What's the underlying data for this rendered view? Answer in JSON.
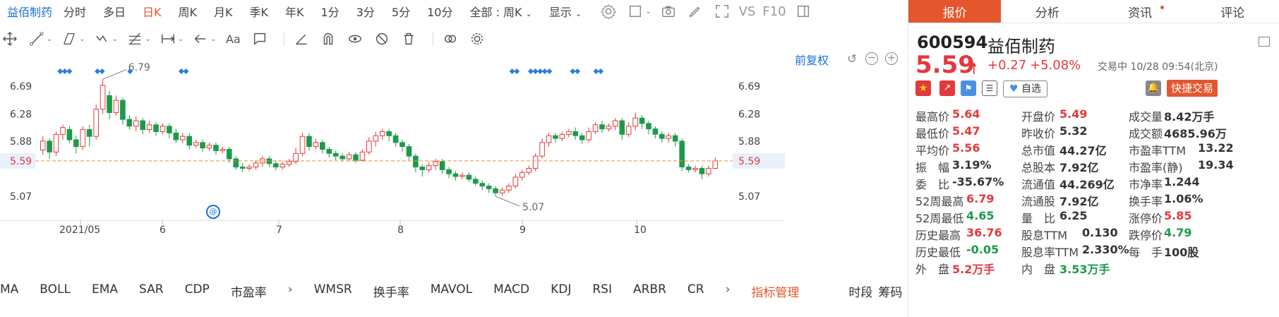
{
  "period_bar": {
    "stock_name": "益佰制药",
    "periods": [
      "分时",
      "多日",
      "日K",
      "周K",
      "月K",
      "季K",
      "年K",
      "1分",
      "3分",
      "5分",
      "10分"
    ],
    "active_index": 2,
    "range_select": "全部 : 周K",
    "display_label": "显示",
    "vs_label": "VS",
    "f10_label": "F10"
  },
  "chart_header": {
    "adjust_label": "前复权"
  },
  "chart_data": {
    "type": "candlestick",
    "price_ticks": [
      "6.69",
      "6.28",
      "5.88",
      "5.59",
      "5.07"
    ],
    "price_tick_values": [
      6.69,
      6.28,
      5.88,
      5.59,
      5.07
    ],
    "current_price_label": "5.59",
    "high_annotation": "6.79",
    "low_annotation": "5.07",
    "x_labels": [
      "2021/05",
      "6",
      "7",
      "8",
      "9",
      "10"
    ],
    "ylim": [
      4.8,
      7.0
    ],
    "up_color": "#e4393c",
    "down_color": "#1c9a4a",
    "candles": [
      [
        5.75,
        5.88,
        5.68,
        5.95
      ],
      [
        5.88,
        5.72,
        5.62,
        5.92
      ],
      [
        5.72,
        5.98,
        5.66,
        6.02
      ],
      [
        5.98,
        6.08,
        5.9,
        6.12
      ],
      [
        6.05,
        5.9,
        5.85,
        6.1
      ],
      [
        5.9,
        5.8,
        5.7,
        5.96
      ],
      [
        5.8,
        6.05,
        5.75,
        6.1
      ],
      [
        6.05,
        5.95,
        5.8,
        6.12
      ],
      [
        5.95,
        6.35,
        5.9,
        6.42
      ],
      [
        6.35,
        6.7,
        6.28,
        6.79
      ],
      [
        6.55,
        6.3,
        6.2,
        6.62
      ],
      [
        6.3,
        6.48,
        6.25,
        6.55
      ],
      [
        6.48,
        6.2,
        6.12,
        6.52
      ],
      [
        6.2,
        6.1,
        6.05,
        6.26
      ],
      [
        6.1,
        6.18,
        6.02,
        6.24
      ],
      [
        6.18,
        6.05,
        5.98,
        6.22
      ],
      [
        6.05,
        6.12,
        6.0,
        6.18
      ],
      [
        6.12,
        6.02,
        5.96,
        6.16
      ],
      [
        6.02,
        6.1,
        5.98,
        6.14
      ],
      [
        6.1,
        6.0,
        5.92,
        6.14
      ],
      [
        6.0,
        5.9,
        5.85,
        6.06
      ],
      [
        5.9,
        5.95,
        5.85,
        6.0
      ],
      [
        5.95,
        5.82,
        5.76,
        6.0
      ],
      [
        5.82,
        5.86,
        5.78,
        5.9
      ],
      [
        5.86,
        5.78,
        5.72,
        5.9
      ],
      [
        5.78,
        5.82,
        5.74,
        5.86
      ],
      [
        5.82,
        5.74,
        5.68,
        5.86
      ],
      [
        5.74,
        5.76,
        5.7,
        5.8
      ],
      [
        5.76,
        5.62,
        5.56,
        5.8
      ],
      [
        5.62,
        5.5,
        5.46,
        5.66
      ],
      [
        5.5,
        5.48,
        5.42,
        5.56
      ],
      [
        5.48,
        5.5,
        5.44,
        5.54
      ],
      [
        5.5,
        5.56,
        5.46,
        5.6
      ],
      [
        5.56,
        5.62,
        5.5,
        5.66
      ],
      [
        5.62,
        5.55,
        5.5,
        5.66
      ],
      [
        5.55,
        5.5,
        5.45,
        5.6
      ],
      [
        5.5,
        5.54,
        5.46,
        5.58
      ],
      [
        5.54,
        5.58,
        5.5,
        5.62
      ],
      [
        5.58,
        5.7,
        5.54,
        5.78
      ],
      [
        5.7,
        5.95,
        5.66,
        6.0
      ],
      [
        5.95,
        5.8,
        5.74,
        6.0
      ],
      [
        5.8,
        5.86,
        5.76,
        5.92
      ],
      [
        5.86,
        5.76,
        5.7,
        5.9
      ],
      [
        5.76,
        5.7,
        5.64,
        5.8
      ],
      [
        5.7,
        5.66,
        5.6,
        5.74
      ],
      [
        5.66,
        5.62,
        5.58,
        5.7
      ],
      [
        5.62,
        5.68,
        5.58,
        5.72
      ],
      [
        5.68,
        5.6,
        5.56,
        5.72
      ],
      [
        5.6,
        5.72,
        5.58,
        5.76
      ],
      [
        5.72,
        5.88,
        5.68,
        5.94
      ],
      [
        5.88,
        5.96,
        5.8,
        6.02
      ],
      [
        5.96,
        6.02,
        5.9,
        6.06
      ],
      [
        6.02,
        5.96,
        5.88,
        6.06
      ],
      [
        5.96,
        5.86,
        5.8,
        6.0
      ],
      [
        5.86,
        5.8,
        5.72,
        5.9
      ],
      [
        5.8,
        5.66,
        5.6,
        5.84
      ],
      [
        5.66,
        5.5,
        5.42,
        5.7
      ],
      [
        5.5,
        5.46,
        5.36,
        5.54
      ],
      [
        5.46,
        5.52,
        5.42,
        5.58
      ],
      [
        5.52,
        5.58,
        5.46,
        5.62
      ],
      [
        5.58,
        5.46,
        5.4,
        5.62
      ],
      [
        5.46,
        5.4,
        5.34,
        5.5
      ],
      [
        5.4,
        5.36,
        5.3,
        5.44
      ],
      [
        5.36,
        5.38,
        5.32,
        5.42
      ],
      [
        5.38,
        5.32,
        5.28,
        5.42
      ],
      [
        5.32,
        5.26,
        5.22,
        5.36
      ],
      [
        5.26,
        5.22,
        5.16,
        5.3
      ],
      [
        5.22,
        5.18,
        5.12,
        5.26
      ],
      [
        5.18,
        5.12,
        5.07,
        5.22
      ],
      [
        5.12,
        5.16,
        5.08,
        5.2
      ],
      [
        5.16,
        5.22,
        5.12,
        5.26
      ],
      [
        5.22,
        5.35,
        5.18,
        5.4
      ],
      [
        5.35,
        5.42,
        5.3,
        5.46
      ],
      [
        5.42,
        5.48,
        5.38,
        5.52
      ],
      [
        5.48,
        5.66,
        5.44,
        5.7
      ],
      [
        5.66,
        5.86,
        5.62,
        5.92
      ],
      [
        5.86,
        5.96,
        5.8,
        6.0
      ],
      [
        5.96,
        5.92,
        5.86,
        6.0
      ],
      [
        5.92,
        5.98,
        5.88,
        6.02
      ],
      [
        5.98,
        6.02,
        5.94,
        6.06
      ],
      [
        6.02,
        5.96,
        5.9,
        6.08
      ],
      [
        5.96,
        5.9,
        5.84,
        6.0
      ],
      [
        5.9,
        6.02,
        5.86,
        6.08
      ],
      [
        6.02,
        6.12,
        5.98,
        6.16
      ],
      [
        6.12,
        6.06,
        6.0,
        6.18
      ],
      [
        6.06,
        6.1,
        6.02,
        6.14
      ],
      [
        6.1,
        6.18,
        6.04,
        6.22
      ],
      [
        6.18,
        5.98,
        5.9,
        6.22
      ],
      [
        5.98,
        6.1,
        5.94,
        6.16
      ],
      [
        6.1,
        6.22,
        6.04,
        6.3
      ],
      [
        6.22,
        6.14,
        6.06,
        6.26
      ],
      [
        6.14,
        6.06,
        5.98,
        6.18
      ],
      [
        6.06,
        5.98,
        5.92,
        6.1
      ],
      [
        5.98,
        5.92,
        5.86,
        6.02
      ],
      [
        5.92,
        5.96,
        5.86,
        6.0
      ],
      [
        5.96,
        5.88,
        5.8,
        6.0
      ],
      [
        5.88,
        5.5,
        5.44,
        5.92
      ],
      [
        5.5,
        5.46,
        5.42,
        5.54
      ],
      [
        5.46,
        5.48,
        5.42,
        5.52
      ],
      [
        5.48,
        5.4,
        5.32,
        5.52
      ],
      [
        5.4,
        5.48,
        5.36,
        5.52
      ],
      [
        5.48,
        5.59,
        5.47,
        5.64
      ]
    ]
  },
  "right_panel": {
    "tabs": [
      "报价",
      "分析",
      "资讯",
      "评论"
    ],
    "active_tab": 0,
    "code": "600594",
    "name": "益佰制药",
    "price": "5.59",
    "change": "+0.27",
    "change_pct": "+5.08%",
    "status": "交易中 10/28 09:54(北京)",
    "fav_label": "自选",
    "quick_trade": "快捷交易",
    "quote_rows": [
      [
        [
          "最高价",
          "5.64",
          "up"
        ],
        [
          "开盘价",
          "5.49",
          "up"
        ],
        [
          "成交量",
          "8.42万手",
          "normal"
        ]
      ],
      [
        [
          "最低价",
          "5.47",
          "up"
        ],
        [
          "昨收价",
          "5.32",
          "normal"
        ],
        [
          "成交额",
          "4685.96万",
          "normal"
        ]
      ],
      [
        [
          "平均价",
          "5.56",
          "up"
        ],
        [
          "总市值",
          "44.27亿",
          "normal"
        ],
        [
          "市盈率TTM",
          "13.22",
          "normal"
        ]
      ],
      [
        [
          "振　幅",
          "3.19%",
          "normal"
        ],
        [
          "总股本",
          "7.92亿",
          "normal"
        ],
        [
          "市盈率(静)",
          "19.34",
          "normal"
        ]
      ],
      [
        [
          "委　比",
          "-35.67%",
          "normal"
        ],
        [
          "流通值",
          "44.269亿",
          "normal"
        ],
        [
          "市净率",
          "1.244",
          "normal"
        ]
      ],
      [
        [
          "52周最高",
          "6.79",
          "up"
        ],
        [
          "流通股",
          "7.92亿",
          "normal"
        ],
        [
          "换手率",
          "1.06%",
          "normal"
        ]
      ],
      [
        [
          "52周最低",
          "4.65",
          "down"
        ],
        [
          "量　比",
          "6.25",
          "normal"
        ],
        [
          "涨停价",
          "5.85",
          "up"
        ]
      ],
      [
        [
          "历史最高",
          "36.76",
          "up"
        ],
        [
          "股息TTM",
          "0.130",
          "normal"
        ],
        [
          "跌停价",
          "4.79",
          "down"
        ]
      ],
      [
        [
          "历史最低",
          "-0.05",
          "down"
        ],
        [
          "股息率TTM",
          "2.330%",
          "normal"
        ],
        [
          "每　手",
          "100股",
          "normal"
        ]
      ],
      [
        [
          "外　盘",
          "5.2万手",
          "up"
        ],
        [
          "内　盘",
          "3.53万手",
          "down"
        ],
        [
          "",
          "",
          ""
        ]
      ]
    ]
  },
  "indicator_bar": {
    "items": [
      "MA",
      "BOLL",
      "EMA",
      "SAR",
      "CDP",
      "市盈率",
      "WMSR",
      "换手率",
      "MAVOL",
      "MACD",
      "KDJ",
      "RSI",
      "ARBR",
      "CR"
    ],
    "manage_label": "指标管理",
    "timeframe_label": "时段",
    "chips_label": "筹码"
  },
  "colors": {
    "accent": "#e4572e",
    "link": "#1a6fd6",
    "up": "#e4393c",
    "down": "#1c9a4a"
  }
}
